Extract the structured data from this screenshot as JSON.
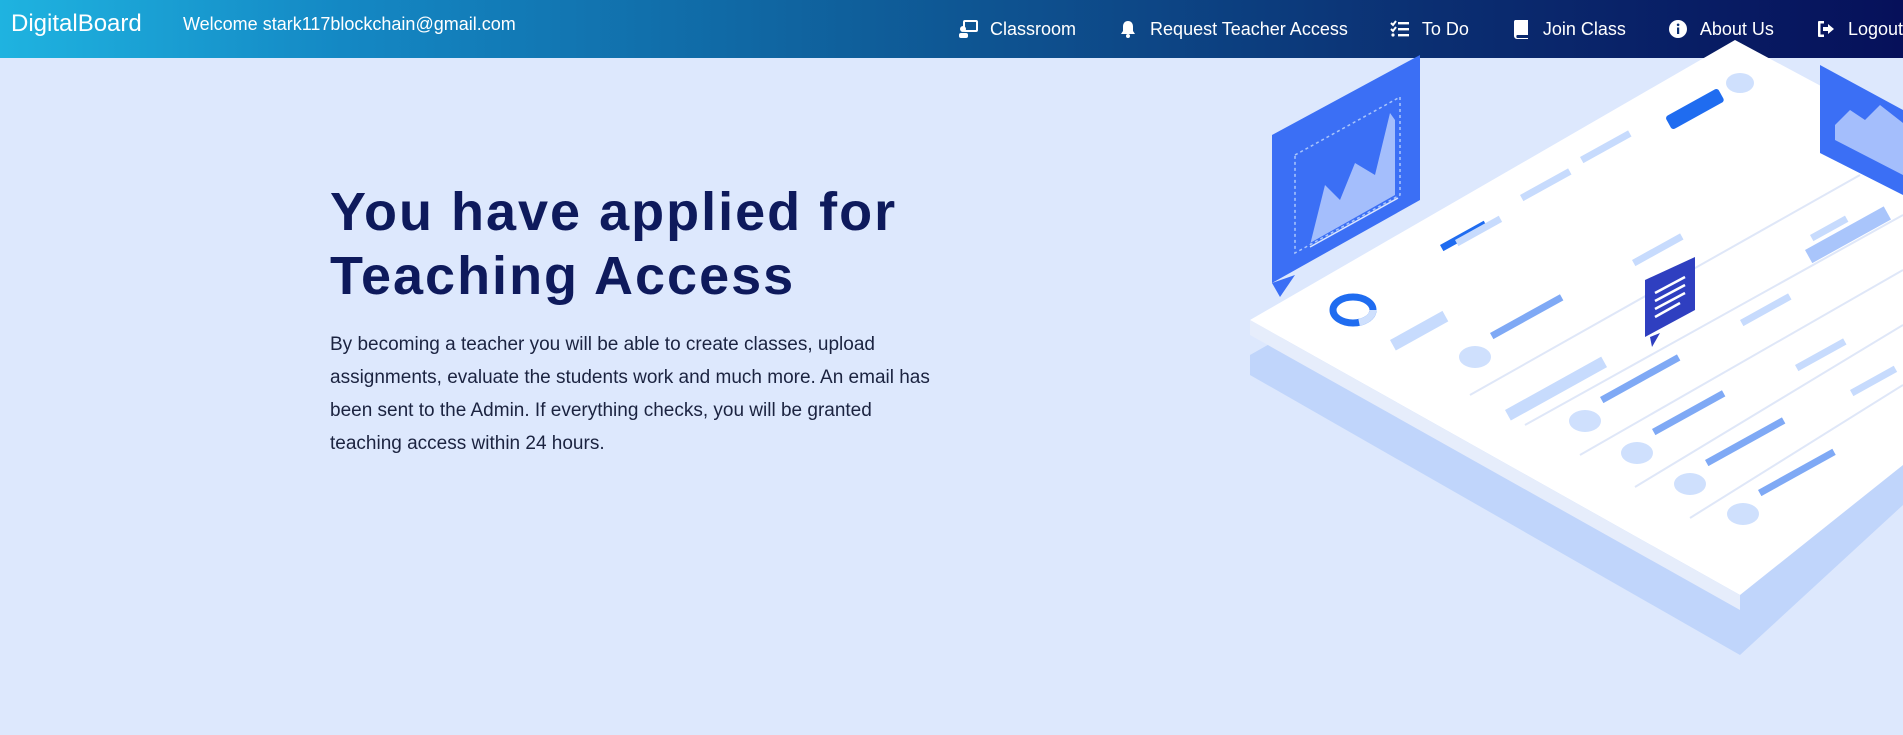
{
  "navbar": {
    "brand": "DigitalBoard",
    "welcome": "Welcome stark117blockchain@gmail.com",
    "items": [
      {
        "label": "Classroom",
        "icon": "classroom-icon"
      },
      {
        "label": "Request Teacher Access",
        "icon": "bell-icon"
      },
      {
        "label": "To Do",
        "icon": "checklist-icon"
      },
      {
        "label": "Join Class",
        "icon": "book-icon"
      },
      {
        "label": "About Us",
        "icon": "info-icon"
      },
      {
        "label": "Logout",
        "icon": "logout-icon"
      }
    ]
  },
  "hero": {
    "title_line1": "You have applied for",
    "title_line2": "Teaching Access",
    "description": "By becoming a teacher you will be able to create classes, upload assignments, evaluate the students work and much more. An email has been sent to the Admin. If everything checks, you will be granted teaching access within 24 hours."
  },
  "colors": {
    "background": "#dde8fd",
    "title": "#0e1a5c",
    "navbar_start": "#1fb3e0",
    "navbar_end": "#06105a"
  }
}
